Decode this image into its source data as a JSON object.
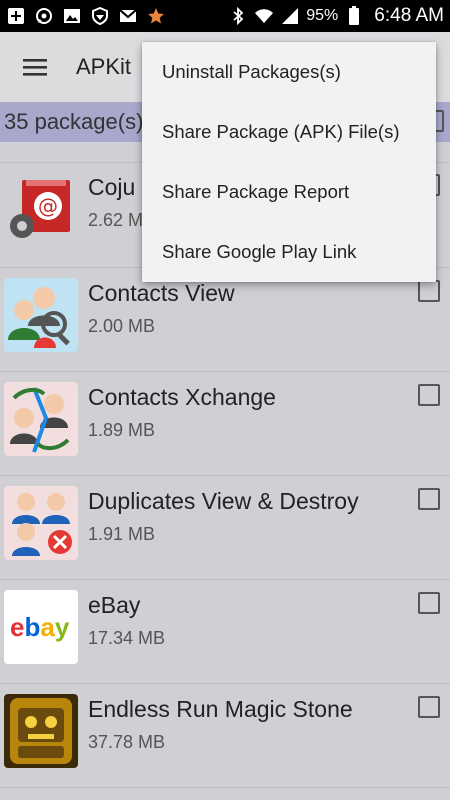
{
  "status_bar": {
    "battery": "95%",
    "time": "6:48 AM",
    "left_icons": [
      "add-box-icon",
      "whatsapp-icon",
      "image-icon",
      "shield-icon",
      "gmail-icon",
      "star-icon"
    ],
    "right_icons": [
      "bluetooth-icon",
      "wifi-icon",
      "signal-icon",
      "battery-icon"
    ]
  },
  "toolbar": {
    "title": "APKit",
    "menu_icon": "hamburger-menu-icon"
  },
  "summary": {
    "text": "35 package(s)"
  },
  "packages": [
    {
      "name": "Coju",
      "size": "2.62 MB",
      "icon": "email-app-icon"
    },
    {
      "name": "Contacts View",
      "size": "2.00 MB",
      "icon": "contacts-view-icon"
    },
    {
      "name": "Contacts Xchange",
      "size": "1.89 MB",
      "icon": "contacts-xchange-icon"
    },
    {
      "name": "Duplicates View & Destroy",
      "size": "1.91 MB",
      "icon": "duplicates-icon"
    },
    {
      "name": "eBay",
      "size": "17.34 MB",
      "icon": "ebay-icon",
      "logo_letters": [
        "e",
        "b",
        "a",
        "y"
      ]
    },
    {
      "name": "Endless Run Magic Stone",
      "size": "37.78 MB",
      "icon": "endless-run-icon"
    }
  ],
  "overflow_menu": {
    "items": [
      "Uninstall Packages(s)",
      "Share Package (APK) File(s)",
      "Share Package Report",
      "Share Google Play Link"
    ]
  },
  "colors": {
    "status_bar": "#000000",
    "toolbar": "#dcdcdf",
    "summary_bar": "#a9a8cc",
    "list_background": "#cfcfd4",
    "menu_background": "#f2f2f2"
  }
}
